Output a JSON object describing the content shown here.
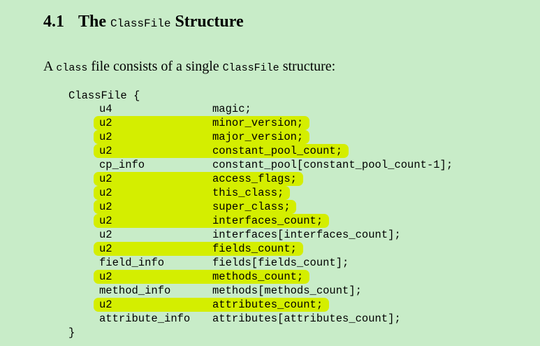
{
  "heading": {
    "number": "4.1",
    "word_the": "The",
    "code_name": "ClassFile",
    "word_structure": "Structure"
  },
  "intro": {
    "part1": "A ",
    "code1": "class",
    "part2": " file consists of a single ",
    "code2": "ClassFile",
    "part3": " structure:"
  },
  "code": {
    "open": "ClassFile {",
    "close": "}",
    "highlight_color": "#d4ee00",
    "rows": [
      {
        "type": "u4",
        "field": "magic;",
        "highlighted": false
      },
      {
        "type": "u2",
        "field": "minor_version;",
        "highlighted": true
      },
      {
        "type": "u2",
        "field": "major_version;",
        "highlighted": true
      },
      {
        "type": "u2",
        "field": "constant_pool_count;",
        "highlighted": true
      },
      {
        "type": "cp_info",
        "field": "constant_pool[constant_pool_count-1];",
        "highlighted": false
      },
      {
        "type": "u2",
        "field": "access_flags;",
        "highlighted": true
      },
      {
        "type": "u2",
        "field": "this_class;",
        "highlighted": true
      },
      {
        "type": "u2",
        "field": "super_class;",
        "highlighted": true
      },
      {
        "type": "u2",
        "field": "interfaces_count;",
        "highlighted": true
      },
      {
        "type": "u2",
        "field": "interfaces[interfaces_count];",
        "highlighted": false
      },
      {
        "type": "u2",
        "field": "fields_count;",
        "highlighted": true
      },
      {
        "type": "field_info",
        "field": "fields[fields_count];",
        "highlighted": false
      },
      {
        "type": "u2",
        "field": "methods_count;",
        "highlighted": true
      },
      {
        "type": "method_info",
        "field": "methods[methods_count];",
        "highlighted": false
      },
      {
        "type": "u2",
        "field": "attributes_count;",
        "highlighted": true
      },
      {
        "type": "attribute_info",
        "field": "attributes[attributes_count];",
        "highlighted": false
      }
    ]
  }
}
